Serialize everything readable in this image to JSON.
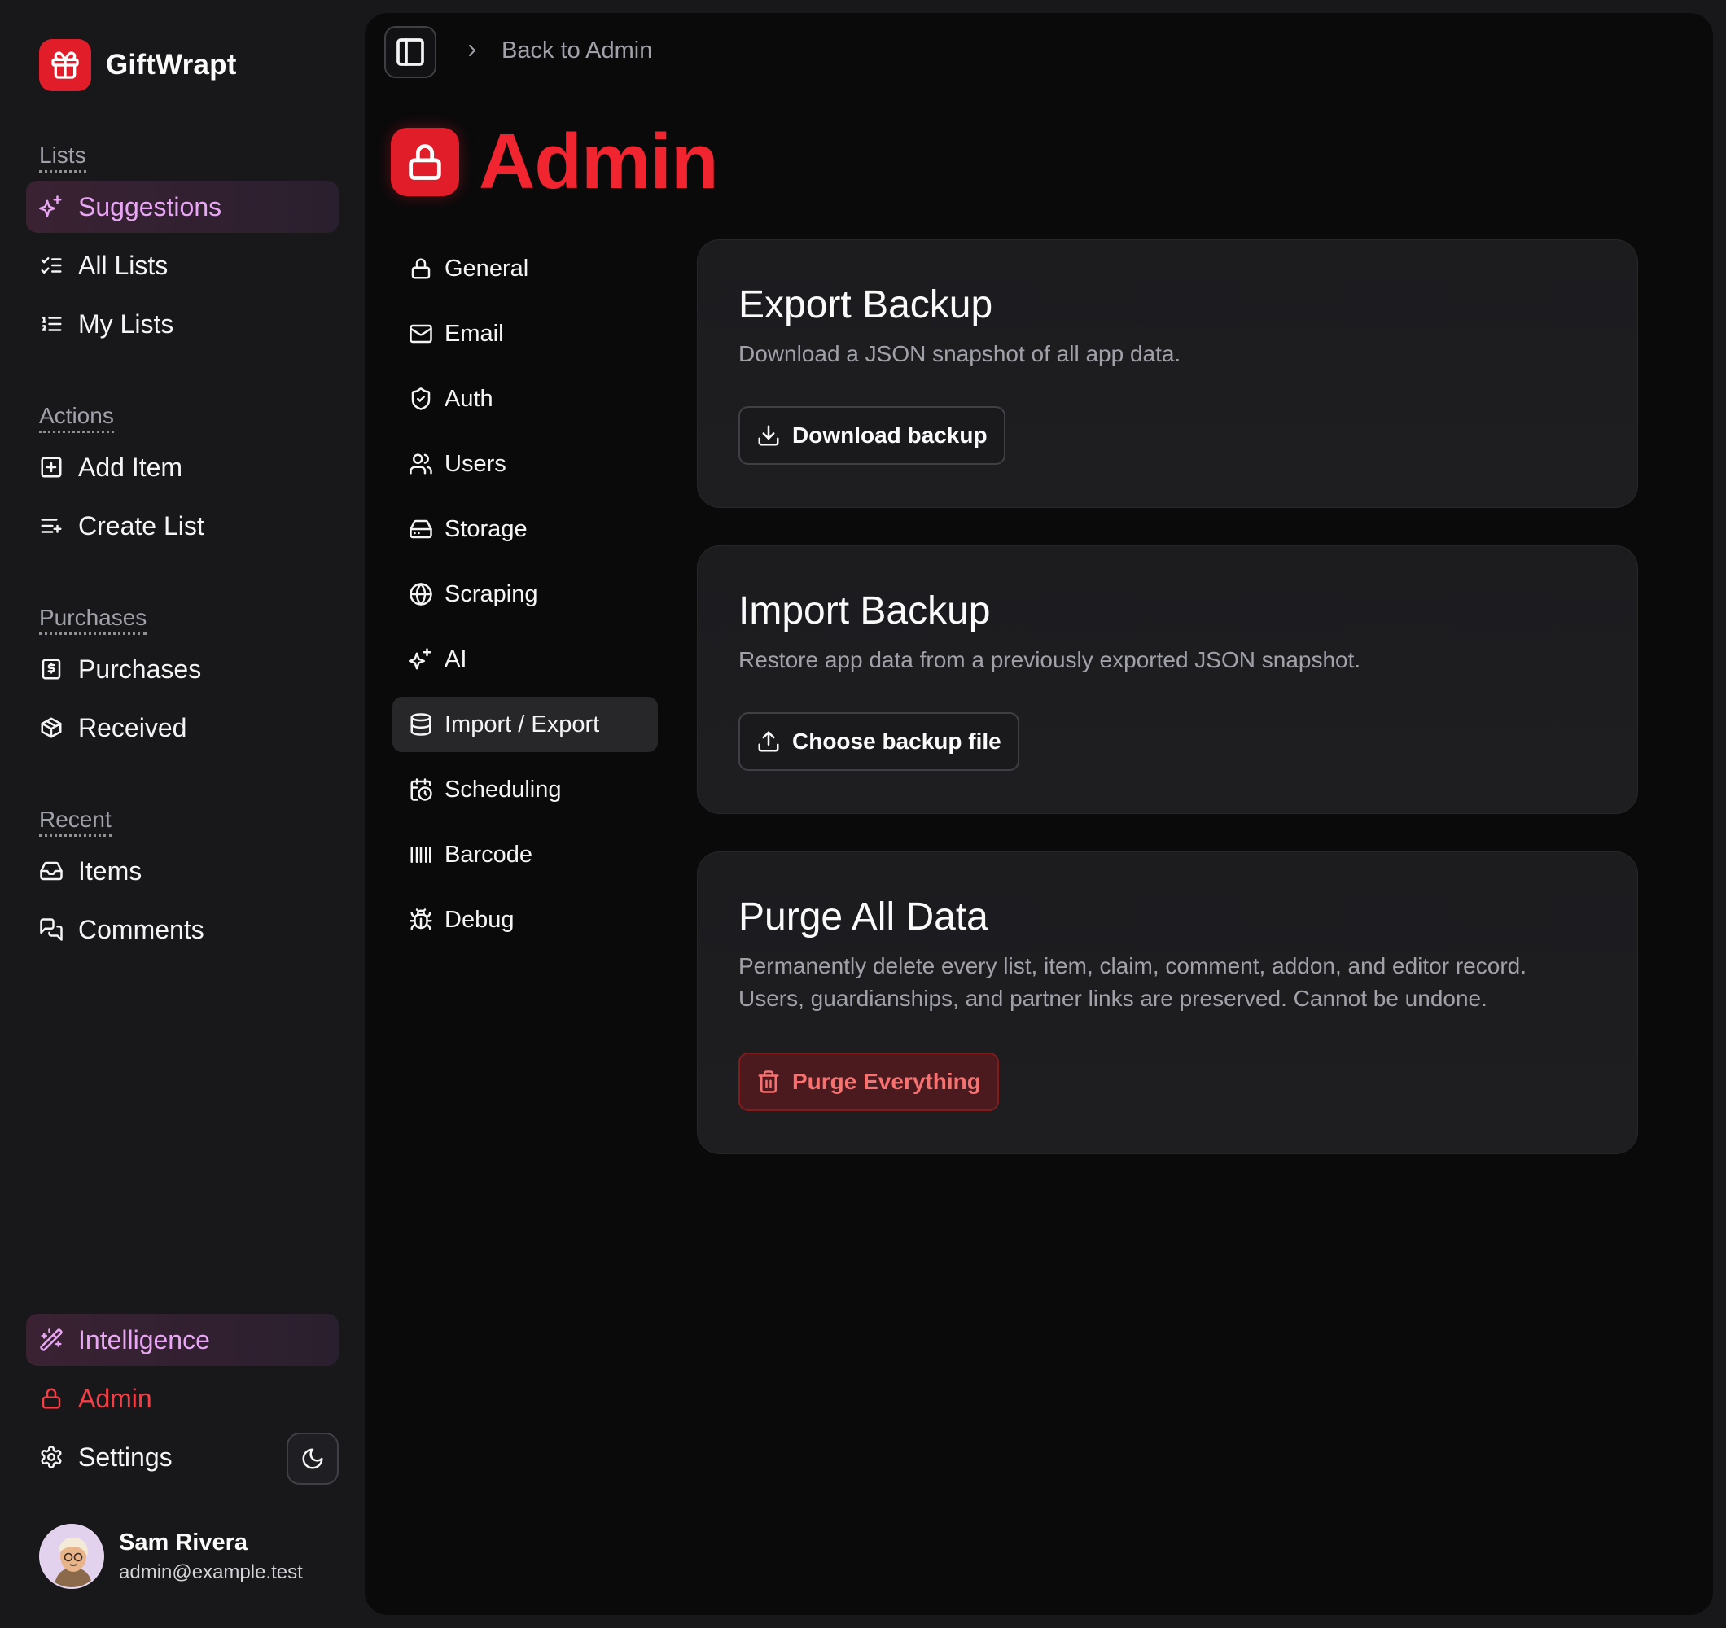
{
  "app": {
    "name": "GiftWrapt"
  },
  "sidebar": {
    "sections": [
      {
        "label": "Lists",
        "items": [
          {
            "label": "Suggestions",
            "icon": "sparkles-icon",
            "active": true
          },
          {
            "label": "All Lists",
            "icon": "list-checks-icon"
          },
          {
            "label": "My Lists",
            "icon": "list-ordered-icon"
          }
        ]
      },
      {
        "label": "Actions",
        "items": [
          {
            "label": "Add Item",
            "icon": "square-plus-icon"
          },
          {
            "label": "Create List",
            "icon": "list-plus-icon"
          }
        ]
      },
      {
        "label": "Purchases",
        "items": [
          {
            "label": "Purchases",
            "icon": "receipt-icon"
          },
          {
            "label": "Received",
            "icon": "package-icon"
          }
        ]
      },
      {
        "label": "Recent",
        "items": [
          {
            "label": "Items",
            "icon": "inbox-icon"
          },
          {
            "label": "Comments",
            "icon": "messages-icon"
          }
        ]
      }
    ],
    "footer_items": [
      {
        "label": "Intelligence",
        "icon": "wand-icon"
      },
      {
        "label": "Admin",
        "icon": "lock-icon"
      },
      {
        "label": "Settings",
        "icon": "gear-icon"
      }
    ],
    "theme_toggle_icon": "moon-icon",
    "user": {
      "name": "Sam Rivera",
      "email": "admin@example.test"
    }
  },
  "breadcrumb": {
    "back_label": "Back to Admin"
  },
  "page": {
    "title": "Admin",
    "icon": "lock-icon"
  },
  "subnav": [
    {
      "label": "General",
      "icon": "lock-icon"
    },
    {
      "label": "Email",
      "icon": "mail-icon"
    },
    {
      "label": "Auth",
      "icon": "shield-check-icon"
    },
    {
      "label": "Users",
      "icon": "users-icon"
    },
    {
      "label": "Storage",
      "icon": "hard-drive-icon"
    },
    {
      "label": "Scraping",
      "icon": "globe-icon"
    },
    {
      "label": "AI",
      "icon": "sparkles-icon"
    },
    {
      "label": "Import / Export",
      "icon": "database-icon",
      "active": true
    },
    {
      "label": "Scheduling",
      "icon": "calendar-clock-icon"
    },
    {
      "label": "Barcode",
      "icon": "barcode-icon"
    },
    {
      "label": "Debug",
      "icon": "bug-icon"
    }
  ],
  "cards": {
    "export": {
      "title": "Export Backup",
      "description": "Download a JSON snapshot of all app data.",
      "button": "Download backup"
    },
    "import": {
      "title": "Import Backup",
      "description": "Restore app data from a previously exported JSON snapshot.",
      "button": "Choose backup file"
    },
    "purge": {
      "title": "Purge All Data",
      "description_line1": "Permanently delete every list, item, claim, comment, addon, and editor record.",
      "description_line2": "Users, guardianships, and partner links are preserved. Cannot be undone.",
      "button": "Purge Everything"
    }
  },
  "colors": {
    "brand_red": "#e11d2a",
    "accent_pink": "#e9a6f5",
    "danger_text": "#f87171"
  }
}
